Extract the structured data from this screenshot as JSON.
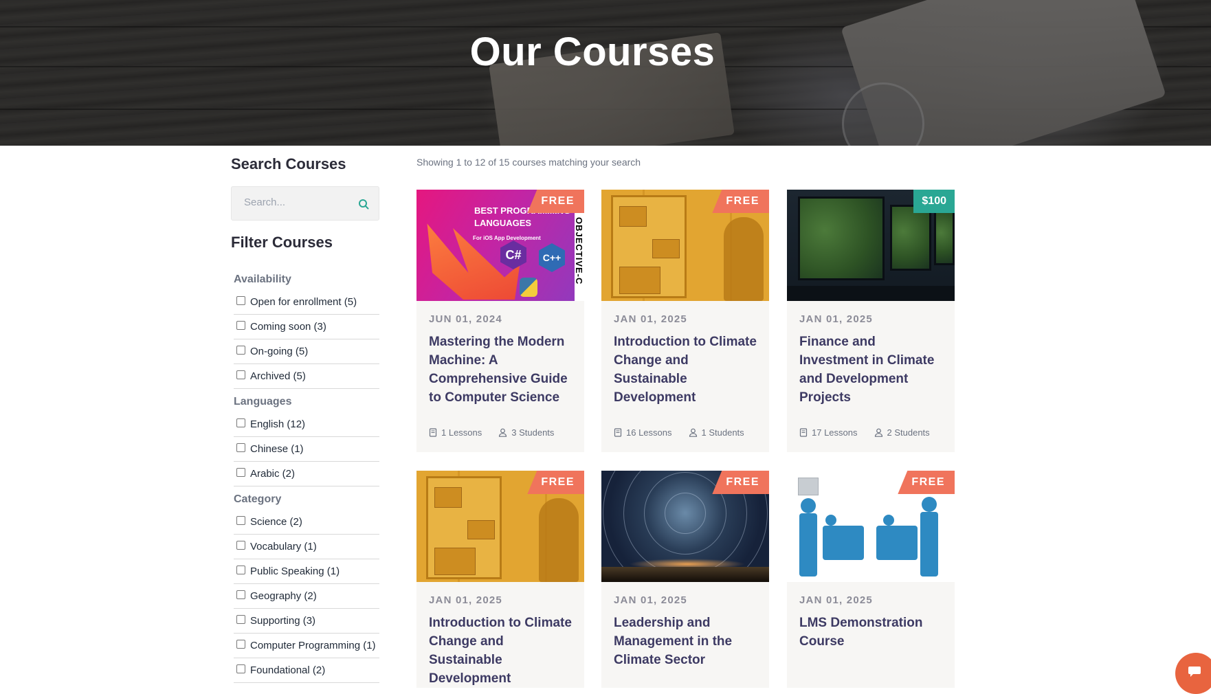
{
  "hero": {
    "title": "Our Courses"
  },
  "sidebar": {
    "search_heading": "Search Courses",
    "search_placeholder": "Search...",
    "filter_heading": "Filter Courses",
    "groups": [
      {
        "title": "Availability",
        "options": [
          "Open for enrollment (5)",
          "Coming soon (3)",
          "On-going (5)",
          "Archived (5)"
        ]
      },
      {
        "title": "Languages",
        "options": [
          "English (12)",
          "Chinese (1)",
          "Arabic (2)"
        ]
      },
      {
        "title": "Category",
        "options": [
          "Science (2)",
          "Vocabulary (1)",
          "Public Speaking (1)",
          "Geography (2)",
          "Supporting (3)",
          "Computer Programming (1)",
          "Foundational (2)"
        ]
      }
    ]
  },
  "main": {
    "showing": "Showing 1 to 12 of 15 courses matching your search",
    "cards": [
      {
        "badge": "FREE",
        "date": "JUN 01, 2024",
        "title": "Mastering the Modern Machine: A Comprehensive Guide to Computer Science",
        "lessons": "1 Lessons",
        "students": "3 Students",
        "thumb_text": "BEST PROGRAMMING LANGUAGES",
        "thumb_sub": "For iOS App Development",
        "thumb_side": "OBJECTIVE-C"
      },
      {
        "badge": "FREE",
        "date": "JAN 01, 2025",
        "title": "Introduction to Climate Change and Sustainable Development",
        "lessons": "16 Lessons",
        "students": "1 Students"
      },
      {
        "badge": "$100",
        "date": "JAN 01, 2025",
        "title": "Finance and Investment in Climate and Development Projects",
        "lessons": "17 Lessons",
        "students": "2 Students"
      },
      {
        "badge": "FREE",
        "date": "JAN 01, 2025",
        "title": "Introduction to Climate Change and Sustainable Development"
      },
      {
        "badge": "FREE",
        "date": "JAN 01, 2025",
        "title": "Leadership and Management in the Climate Sector"
      },
      {
        "badge": "FREE",
        "date": "JAN 01, 2025",
        "title": "LMS Demonstration Course"
      }
    ]
  },
  "colors": {
    "free_badge": "#f0745c",
    "price_badge": "#2aa794",
    "course_title": "#3d3a63",
    "chat_button": "#e8643f"
  },
  "icons": {
    "search": "search-icon",
    "lessons": "book-icon",
    "students": "user-icon",
    "chat": "chat-bubble-icon"
  }
}
